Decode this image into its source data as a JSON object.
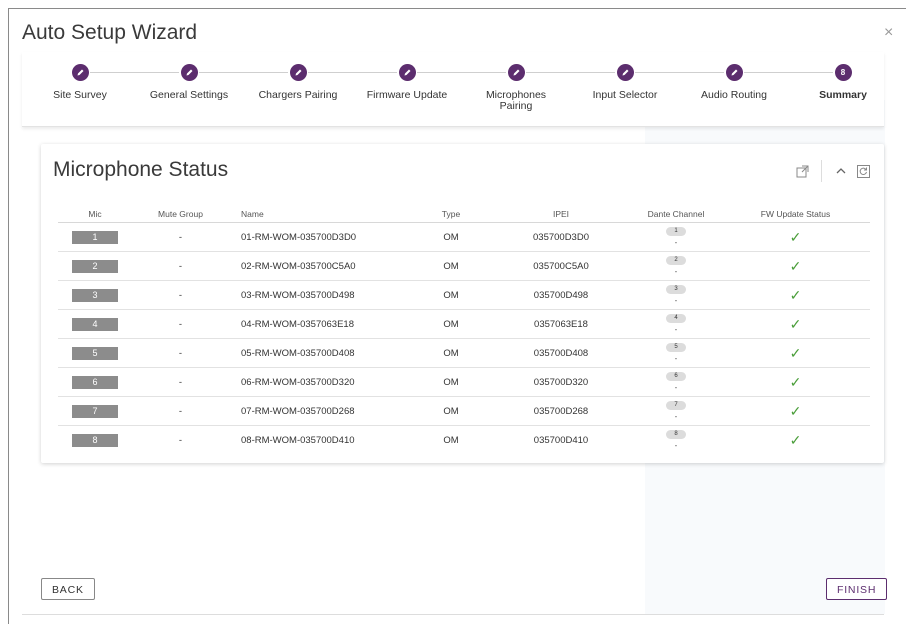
{
  "window": {
    "title": "Auto Setup Wizard",
    "close_glyph": "×"
  },
  "stepper": {
    "steps": [
      {
        "label": "Site Survey",
        "done": true
      },
      {
        "label": "General Settings",
        "done": true
      },
      {
        "label": "Chargers Pairing",
        "done": true
      },
      {
        "label": "Firmware Update",
        "done": true
      },
      {
        "label": "Microphones Pairing",
        "done": true
      },
      {
        "label": "Input Selector",
        "done": true
      },
      {
        "label": "Audio Routing",
        "done": true
      },
      {
        "label": "Summary",
        "done": false,
        "number": "8",
        "active": true
      }
    ]
  },
  "card": {
    "title": "Microphone Status",
    "tools": [
      "external-link-icon",
      "chevron-up-icon",
      "refresh-icon"
    ]
  },
  "table": {
    "headers": [
      "Mic",
      "Mute Group",
      "Name",
      "Type",
      "IPEI",
      "Dante Channel",
      "FW Update Status"
    ],
    "rows": [
      {
        "mic": "1",
        "mute": "-",
        "name": "01-RM-WOM-035700D3D0",
        "type": "OM",
        "ipei": "035700D3D0",
        "dante": "1",
        "dante_sub": "-",
        "fw": "✓"
      },
      {
        "mic": "2",
        "mute": "-",
        "name": "02-RM-WOM-035700C5A0",
        "type": "OM",
        "ipei": "035700C5A0",
        "dante": "2",
        "dante_sub": "-",
        "fw": "✓"
      },
      {
        "mic": "3",
        "mute": "-",
        "name": "03-RM-WOM-035700D498",
        "type": "OM",
        "ipei": "035700D498",
        "dante": "3",
        "dante_sub": "-",
        "fw": "✓"
      },
      {
        "mic": "4",
        "mute": "-",
        "name": "04-RM-WOM-0357063E18",
        "type": "OM",
        "ipei": "0357063E18",
        "dante": "4",
        "dante_sub": "-",
        "fw": "✓"
      },
      {
        "mic": "5",
        "mute": "-",
        "name": "05-RM-WOM-035700D408",
        "type": "OM",
        "ipei": "035700D408",
        "dante": "5",
        "dante_sub": "-",
        "fw": "✓"
      },
      {
        "mic": "6",
        "mute": "-",
        "name": "06-RM-WOM-035700D320",
        "type": "OM",
        "ipei": "035700D320",
        "dante": "6",
        "dante_sub": "-",
        "fw": "✓"
      },
      {
        "mic": "7",
        "mute": "-",
        "name": "07-RM-WOM-035700D268",
        "type": "OM",
        "ipei": "035700D268",
        "dante": "7",
        "dante_sub": "-",
        "fw": "✓"
      },
      {
        "mic": "8",
        "mute": "-",
        "name": "08-RM-WOM-035700D410",
        "type": "OM",
        "ipei": "035700D410",
        "dante": "8",
        "dante_sub": "-",
        "fw": "✓"
      }
    ]
  },
  "footer": {
    "back_label": "BACK",
    "finish_label": "FINISH"
  },
  "colors": {
    "accent": "#5c2d6e",
    "success": "#4a9e3a",
    "badge": "#8c8c8c"
  }
}
